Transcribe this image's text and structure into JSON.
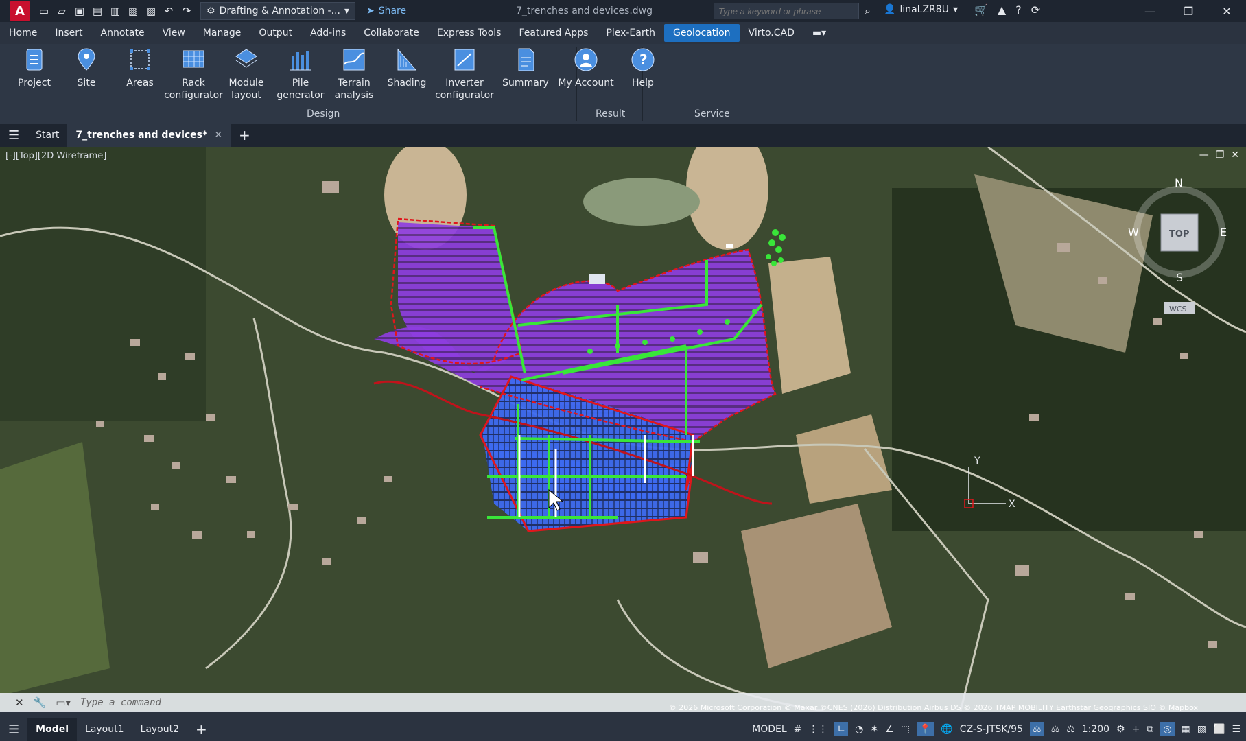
{
  "titlebar": {
    "app_letter": "A",
    "workspace": "Drafting & Annotation -...",
    "share": "Share",
    "document": "7_trenches and devices.dwg",
    "search_placeholder": "Type a keyword or phrase",
    "user": "linaLZR8U"
  },
  "menu": {
    "tabs": [
      "Home",
      "Insert",
      "Annotate",
      "View",
      "Manage",
      "Output",
      "Add-ins",
      "Collaborate",
      "Express Tools",
      "Featured Apps",
      "Plex-Earth",
      "Geolocation",
      "Virto.CAD"
    ],
    "active": "Geolocation"
  },
  "ribbon": {
    "tools": [
      {
        "label": "Project",
        "icon": "project-icon"
      },
      {
        "label": "Site",
        "icon": "site-pin-icon"
      },
      {
        "label": "Areas",
        "icon": "areas-icon"
      },
      {
        "label": "Rack\nconfigurator",
        "icon": "rack-icon"
      },
      {
        "label": "Module\nlayout",
        "icon": "module-icon"
      },
      {
        "label": "Pile\ngenerator",
        "icon": "pile-icon"
      },
      {
        "label": "Terrain\nanalysis",
        "icon": "terrain-icon"
      },
      {
        "label": "Shading",
        "icon": "shading-icon"
      },
      {
        "label": "Inverter\nconfigurator",
        "icon": "inverter-icon"
      },
      {
        "label": "Summary",
        "icon": "summary-icon"
      },
      {
        "label": "My Account",
        "icon": "account-icon"
      },
      {
        "label": "Help",
        "icon": "help-icon"
      }
    ],
    "groups": [
      "Design",
      "Result",
      "Service"
    ]
  },
  "filetabs": {
    "start": "Start",
    "active": "7_trenches and devices*"
  },
  "viewport": {
    "label": "[-][Top][2D Wireframe]",
    "compass": {
      "n": "N",
      "w": "W",
      "e": "E",
      "s": "S",
      "top": "TOP",
      "wcs": "WCS"
    },
    "ucs": {
      "x": "X",
      "y": "Y"
    }
  },
  "command": {
    "placeholder": "Type a command"
  },
  "attribution": "© 2026 Microsoft Corporation © Maxar ©CNES (2026) Distribution Airbus DS © 2026 TMAP MOBILITY Earthstar Geographics SIO © Mapbox",
  "status": {
    "tabs": [
      "Model",
      "Layout1",
      "Layout2"
    ],
    "model": "MODEL",
    "coords": "CZ-S-JTSK/95",
    "scale": "1:200"
  },
  "colors": {
    "accent": "#1d6fc0",
    "boundary": "#e0161c",
    "trench": "#39e639",
    "module_purple": "#8e3de0",
    "module_blue": "#3d6af0"
  }
}
